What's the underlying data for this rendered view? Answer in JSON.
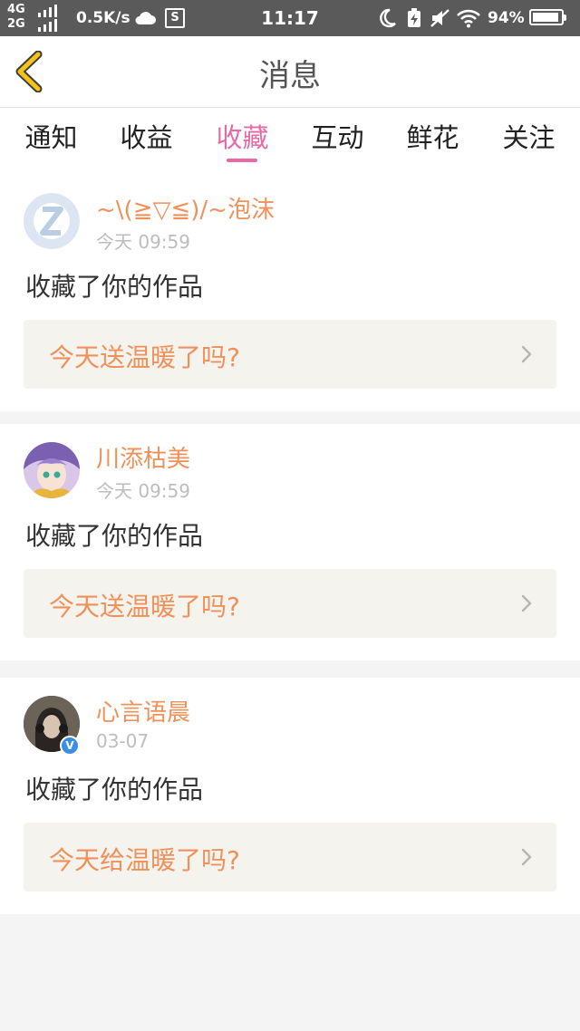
{
  "status_bar": {
    "net_top": "4G",
    "net_bottom": "2G",
    "speed": "0.5K/s",
    "s_icon_label": "S",
    "time": "11:17",
    "battery_pct": "94%",
    "battery_level": 0.94,
    "icons": [
      "signal-icon",
      "cloud-icon",
      "screenshot-icon",
      "moon-icon",
      "charging-icon",
      "mute-icon",
      "wifi-icon",
      "battery-icon"
    ]
  },
  "header": {
    "title": "消息",
    "back_icon": "chevron-left-icon"
  },
  "tabs": [
    {
      "label": "通知",
      "active": false
    },
    {
      "label": "收益",
      "active": false
    },
    {
      "label": "收藏",
      "active": true
    },
    {
      "label": "互动",
      "active": false
    },
    {
      "label": "鲜花",
      "active": false
    },
    {
      "label": "关注",
      "active": false
    }
  ],
  "messages": [
    {
      "username": "~\\(≧▽≦)/~泡沫",
      "time": "今天 09:59",
      "action": "收藏了你的作品",
      "reply": "今天送温暖了吗?",
      "avatar": "default-avatar",
      "verified": false
    },
    {
      "username": "川添枯美",
      "time": "今天 09:59",
      "action": "收藏了你的作品",
      "reply": "今天送温暖了吗?",
      "avatar": "anime-avatar",
      "verified": false
    },
    {
      "username": "心言语晨",
      "time": "03-07",
      "action": "收藏了你的作品",
      "reply": "今天给温暖了吗?",
      "avatar": "photo-avatar",
      "verified": true,
      "badge_label": "V"
    }
  ],
  "colors": {
    "accent_pink": "#e76aa5",
    "accent_orange": "#f0915a",
    "back_yellow": "#f5c318",
    "status_bar_bg": "#5a5a5a"
  }
}
